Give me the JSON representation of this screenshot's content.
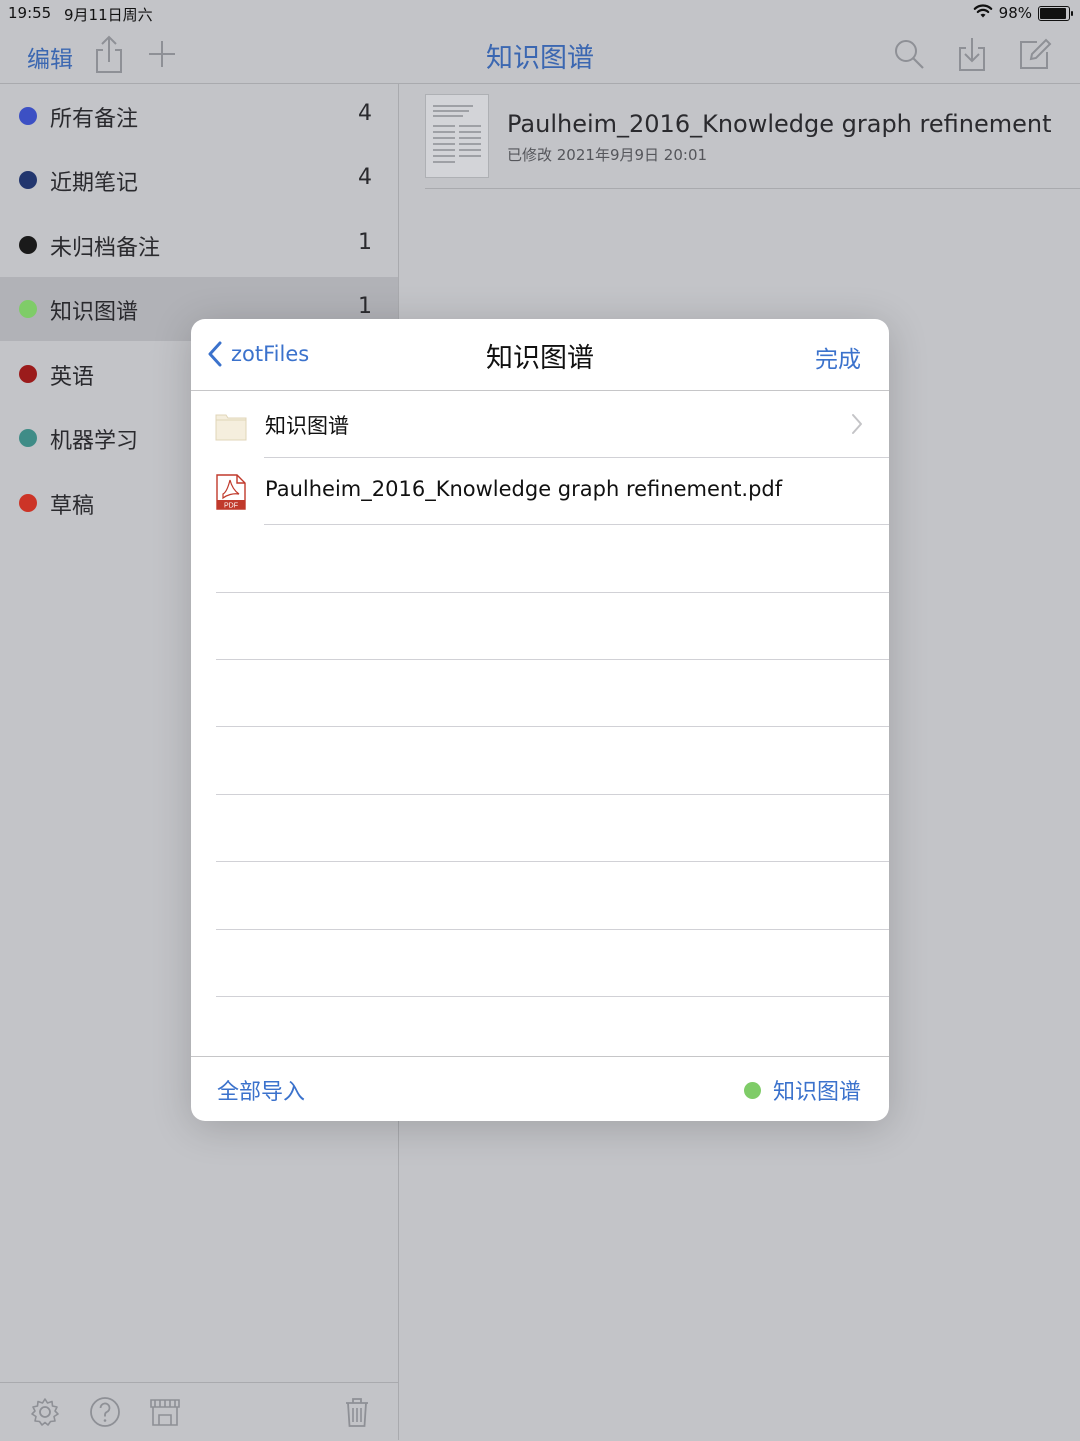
{
  "status_bar": {
    "time": "19:55",
    "date": "9月11日周六",
    "battery": "98%"
  },
  "navbar": {
    "edit_label": "编辑",
    "title": "知识图谱",
    "icons": [
      "share-icon",
      "add-icon",
      "search-icon",
      "import-icon",
      "compose-icon"
    ]
  },
  "sidebar": {
    "items": [
      {
        "label": "所有备注",
        "count": "4",
        "color": "#3c50c4",
        "selected": false
      },
      {
        "label": "近期笔记",
        "count": "4",
        "color": "#22366e",
        "selected": false
      },
      {
        "label": "未归档备注",
        "count": "1",
        "color": "#1a1a1a",
        "selected": false
      },
      {
        "label": "知识图谱",
        "count": "1",
        "color": "#7fcc68",
        "selected": true
      },
      {
        "label": "英语",
        "count": "",
        "color": "#9b1b1b",
        "selected": false
      },
      {
        "label": "机器学习",
        "count": "",
        "color": "#3f8c87",
        "selected": false
      },
      {
        "label": "草稿",
        "count": "",
        "color": "#cc3427",
        "selected": false
      }
    ],
    "toolbar_icons": [
      "gear-icon",
      "help-icon",
      "store-icon",
      "trash-icon"
    ]
  },
  "note_list": {
    "items": [
      {
        "title": "Paulheim_2016_Knowledge graph refinement",
        "modified": "已修改 2021年9月9日 20:01"
      }
    ]
  },
  "modal": {
    "back_label": "zotFiles",
    "title": "知识图谱",
    "done_label": "完成",
    "rows": [
      {
        "type": "folder",
        "name": "知识图谱",
        "icon": "folder-icon"
      },
      {
        "type": "pdf",
        "name": "Paulheim_2016_Knowledge graph refinement.pdf",
        "icon": "pdf-icon",
        "badge": "PDF"
      }
    ],
    "footer": {
      "import_all": "全部导入",
      "target_folder": "知识图谱",
      "target_color": "#7fcc68"
    }
  },
  "colors": {
    "accent": "#3b72cc",
    "nav_accent": "#3b67b1",
    "background": "#c3c4c8"
  }
}
